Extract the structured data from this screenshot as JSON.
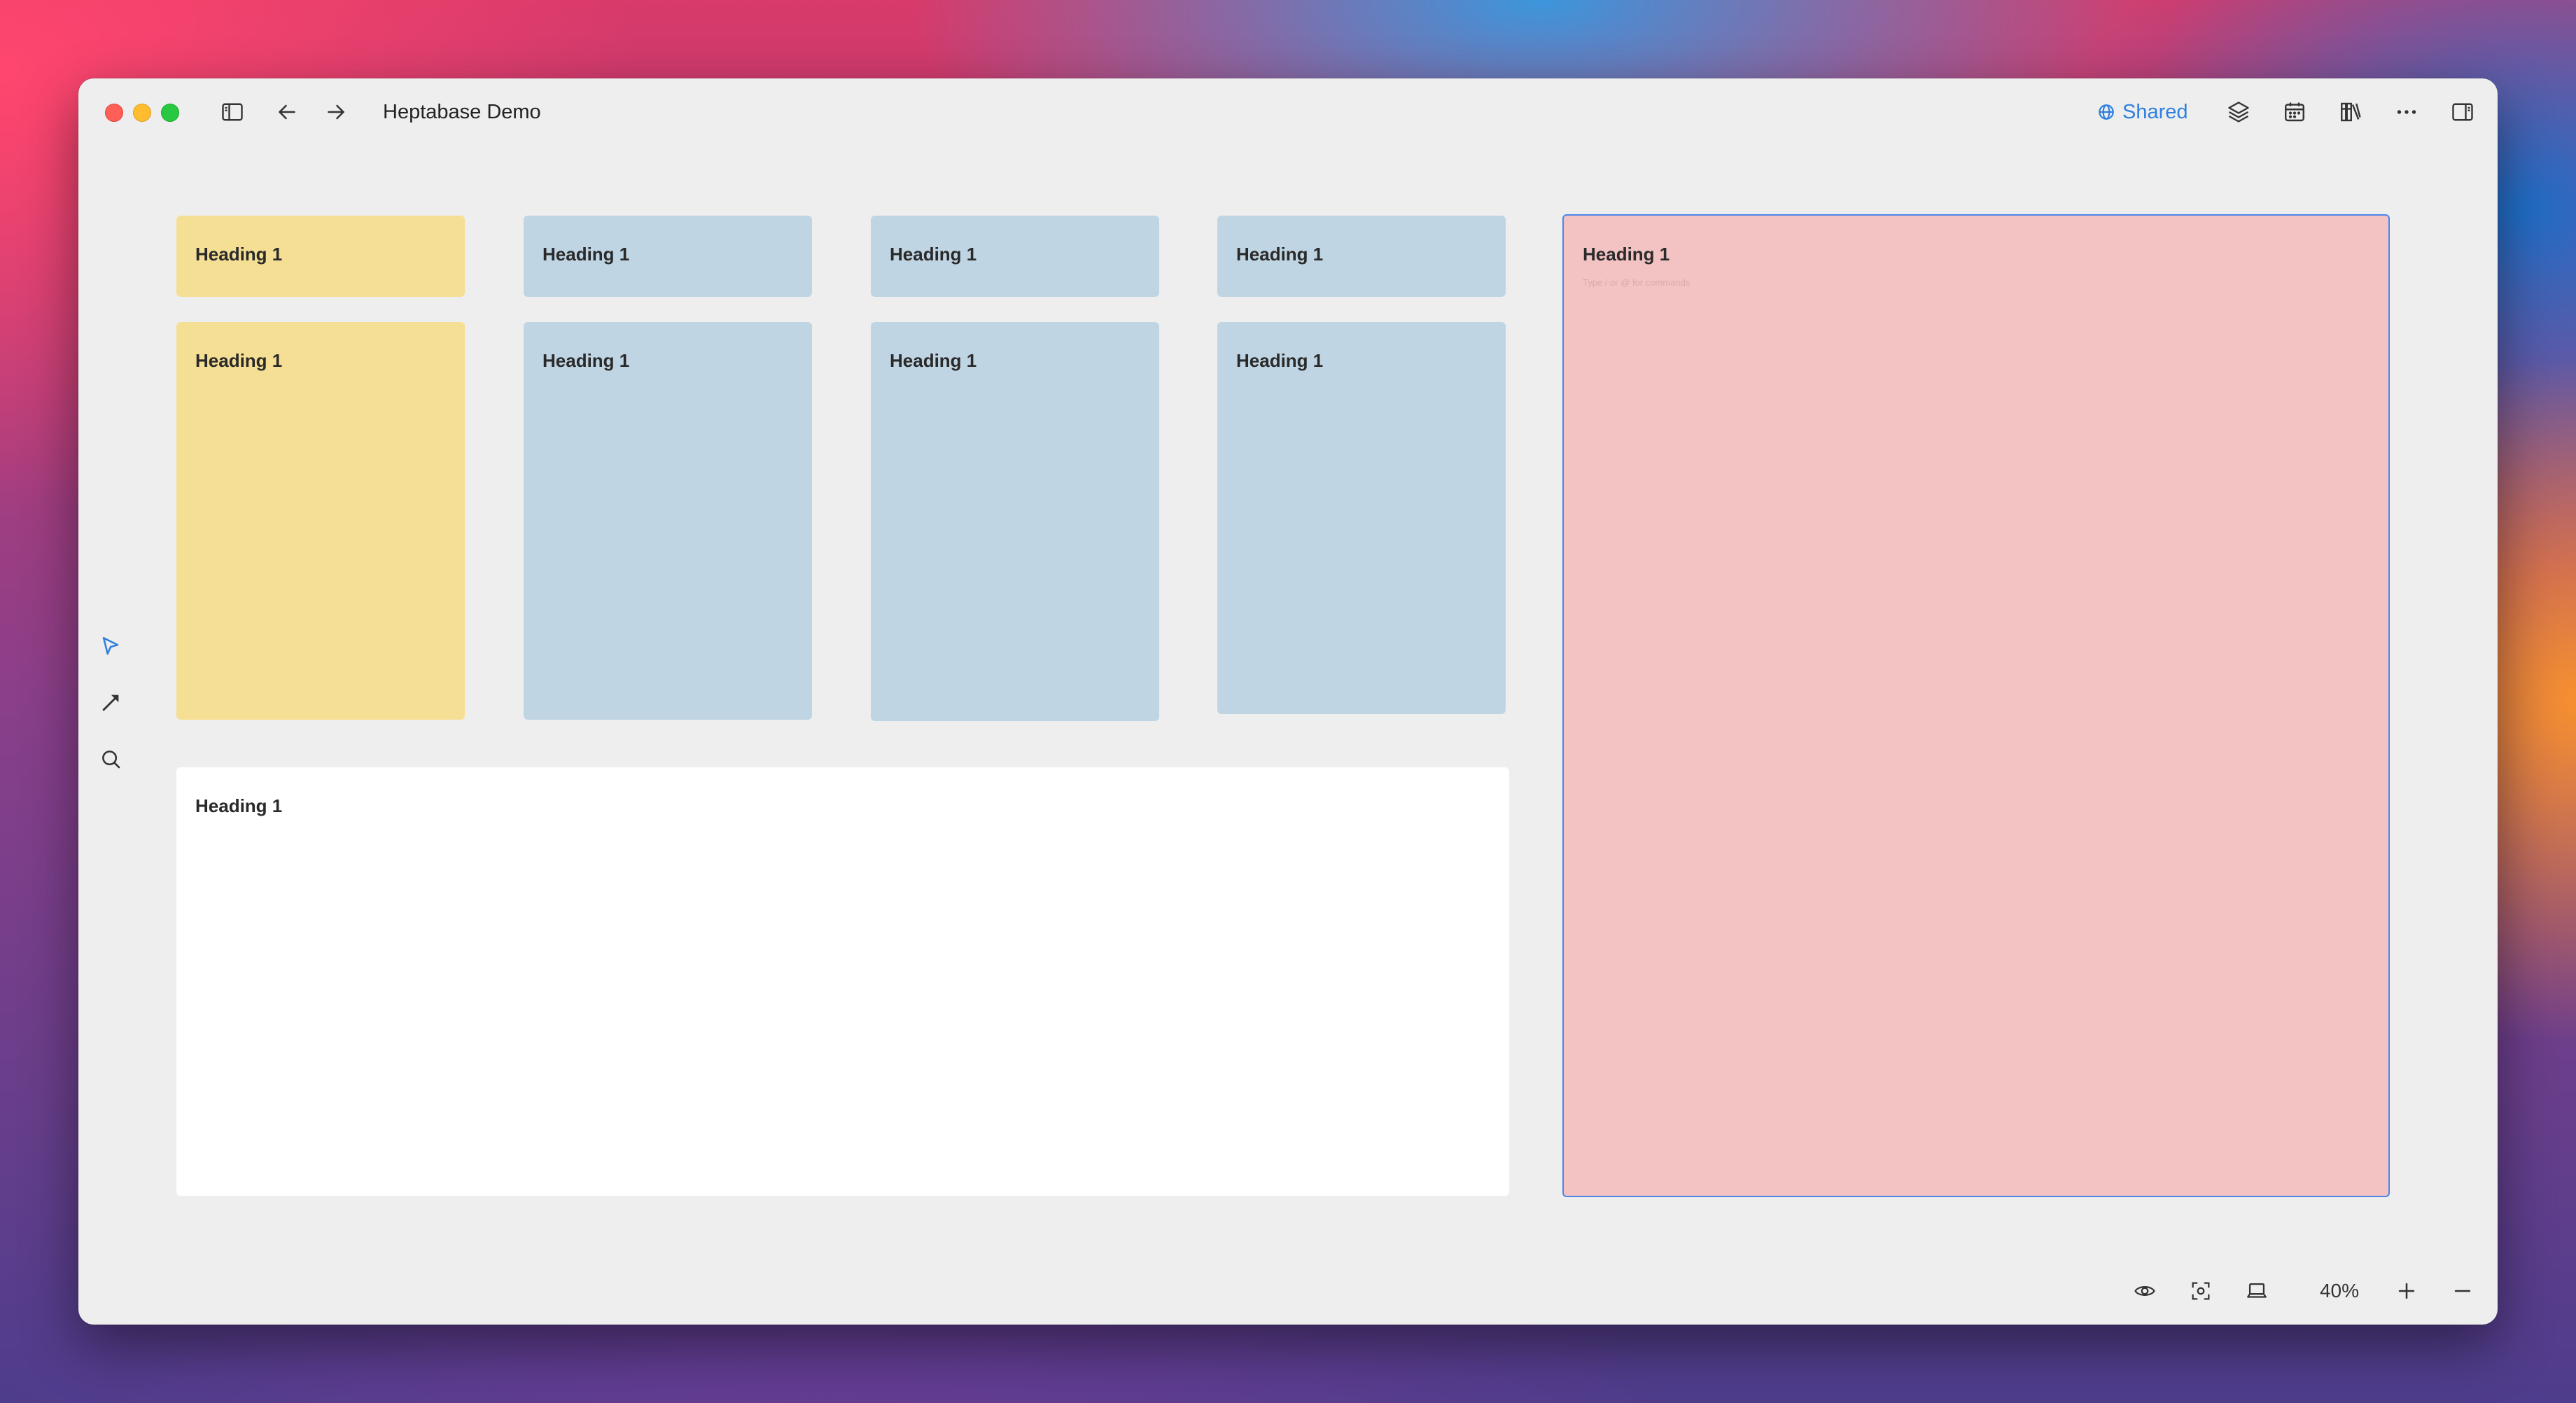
{
  "window": {
    "title": "Heptabase Demo"
  },
  "toolbar": {
    "shared_label": "Shared"
  },
  "canvas": {
    "cards": [
      {
        "heading": "Heading 1",
        "color": "#f5df94"
      },
      {
        "heading": "Heading 1",
        "color": "#c0d5e3"
      },
      {
        "heading": "Heading 1",
        "color": "#c0d5e3"
      },
      {
        "heading": "Heading 1",
        "color": "#c0d5e3"
      },
      {
        "heading": "Heading 1",
        "color": "#f5df94"
      },
      {
        "heading": "Heading 1",
        "color": "#c0d5e3"
      },
      {
        "heading": "Heading 1",
        "color": "#c0d5e3"
      },
      {
        "heading": "Heading 1",
        "color": "#c0d5e3"
      },
      {
        "heading": "Heading 1",
        "color": "#ffffff"
      },
      {
        "heading": "Heading 1",
        "color": "#f3c3c3",
        "hint": "Type / or @ for commands",
        "selected": true
      }
    ]
  },
  "left_tools": [
    "select-icon",
    "pen-icon",
    "search-icon"
  ],
  "bottom_bar": {
    "zoom_label": "40%"
  },
  "colors": {
    "accent": "#2d7fe0",
    "selection": "#4a86e8",
    "window_bg": "#eeeeee"
  }
}
